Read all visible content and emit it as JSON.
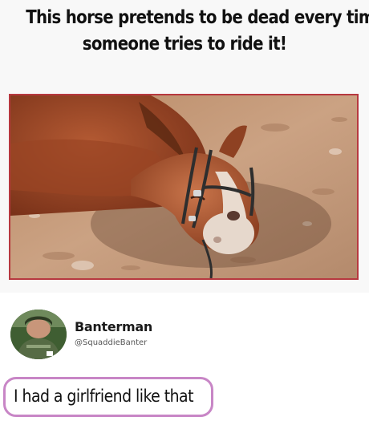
{
  "meme": {
    "caption_line_1": "This horse pretends to be dead every time",
    "caption_line_2": "someone tries to ride it!"
  },
  "tweet": {
    "display_name": "Banterman",
    "handle": "@SquaddieBanter",
    "reply_text": "I had a girlfriend like that"
  },
  "colors": {
    "photo_border": "#b7383f",
    "reply_outline": "#c886c6"
  }
}
